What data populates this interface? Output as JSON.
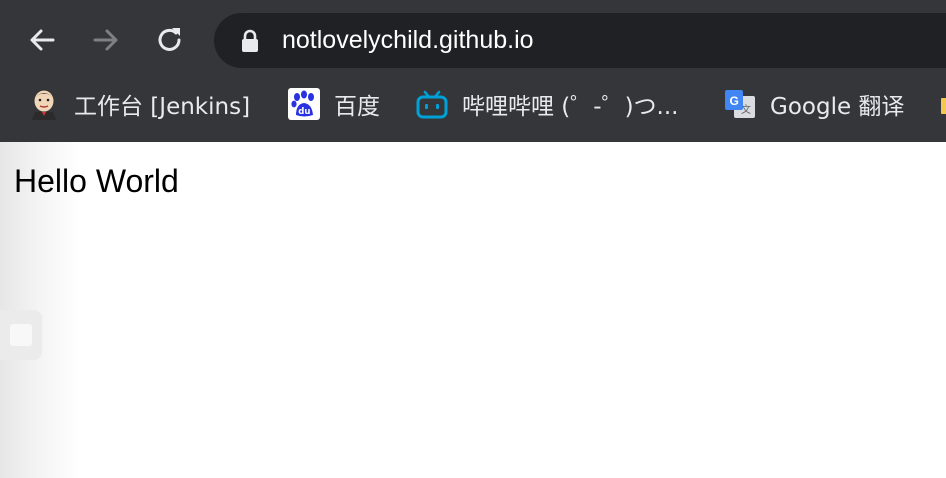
{
  "toolbar": {
    "back_icon": "arrow-left-icon",
    "forward_icon": "arrow-right-icon",
    "reload_icon": "reload-icon",
    "address_bar": {
      "lock_icon": "lock-icon",
      "url": "notlovelychild.github.io"
    }
  },
  "bookmarks": [
    {
      "label": "工作台 [Jenkins]",
      "icon": "jenkins-icon"
    },
    {
      "label": "百度",
      "icon": "baidu-paw-icon"
    },
    {
      "label": "哔哩哔哩 (゜-゜)つ...",
      "icon": "bilibili-tv-icon"
    },
    {
      "label": "Google 翻译",
      "icon": "google-translate-icon"
    }
  ],
  "page": {
    "text": "Hello World"
  },
  "colors": {
    "toolbar_bg": "#35363a",
    "omnibox_bg": "#202124",
    "bilibili_blue": "#00a1d6",
    "google_blue": "#4285f4",
    "baidu_blue": "#2932e1"
  }
}
